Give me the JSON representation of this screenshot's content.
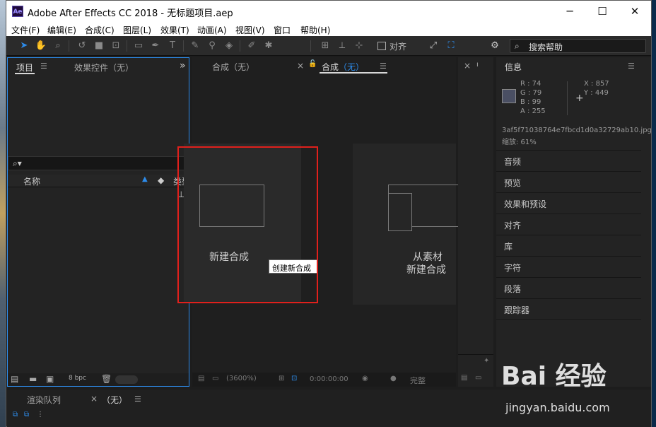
{
  "window": {
    "logo": "Ae",
    "title": "Adobe After Effects CC 2018 - 无标题项目.aep",
    "controls": {
      "minimize": "─",
      "maximize": "☐",
      "close": "✕"
    }
  },
  "menu": [
    "文件(F)",
    "编辑(E)",
    "合成(C)",
    "图层(L)",
    "效果(T)",
    "动画(A)",
    "视图(V)",
    "窗口",
    "帮助(H)"
  ],
  "toolbar": {
    "align_label": "对齐",
    "search_placeholder": "搜索帮助"
  },
  "project_panel": {
    "tab_project": "项目",
    "tab_effects": "效果控件（无）",
    "col_name": "名称",
    "col_type": "类型",
    "bpc": "8 bpc"
  },
  "composition_panel": {
    "tab_comp_none": "合成（无）",
    "tab_comp_active_prefix": "合成",
    "tab_comp_active_value": "（无）",
    "new_comp_label": "新建合成",
    "tooltip": "创建新合成",
    "from_footage_line1": "从素材",
    "from_footage_line2": "新建合成",
    "zoom": "(3600%)",
    "timecode": "0:00:00:00",
    "quality": "完整"
  },
  "info_panel": {
    "title": "信息",
    "r": "R : 74",
    "g": "G : 79",
    "b": "B : 99",
    "a": "A : 255",
    "x": "X : 857",
    "y": "Y : 449",
    "filename": "3af5f71038764e7fbcd1d0a32729ab10.jpg",
    "zoom_line": "缩放: 61%",
    "sample_color": "#4a4f63"
  },
  "side_panels": [
    "音频",
    "预览",
    "效果和预设",
    "对齐",
    "库",
    "字符",
    "段落",
    "跟踪器"
  ],
  "bottom_panel": {
    "tab_render": "渲染队列",
    "tab_none": "（无）"
  },
  "watermark": {
    "brand": "Bai 经验",
    "url": "jingyan.baidu.com"
  },
  "colors": {
    "accent_blue": "#2d8ceb",
    "highlight_red": "#e0201c"
  }
}
